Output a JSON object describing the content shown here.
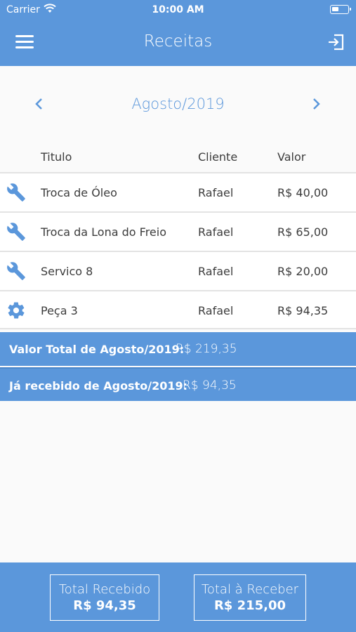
{
  "status": {
    "carrier": "Carrier",
    "time": "10:00 AM"
  },
  "nav": {
    "title": "Receitas",
    "menu_icon": "menu-icon",
    "exit_icon": "exit-icon"
  },
  "month": {
    "label": "Agosto/2019"
  },
  "table": {
    "headers": {
      "titulo": "Titulo",
      "cliente": "Cliente",
      "valor": "Valor"
    },
    "rows": [
      {
        "icon": "wrench-icon",
        "titulo": "Troca de Óleo",
        "cliente": "Rafael",
        "valor": "R$ 40,00"
      },
      {
        "icon": "wrench-icon",
        "titulo": "Troca da Lona do Freio",
        "cliente": "Rafael",
        "valor": "R$ 65,00"
      },
      {
        "icon": "wrench-icon",
        "titulo": "Servico 8",
        "cliente": "Rafael",
        "valor": "R$ 20,00"
      },
      {
        "icon": "gear-icon",
        "titulo": "Peça 3",
        "cliente": "Rafael",
        "valor": "R$ 94,35"
      }
    ]
  },
  "summary": {
    "total_label": "Valor Total de Agosto/2019:",
    "total_value": "R$ 219,35",
    "received_label": "Já recebido de Agosto/2019:",
    "received_value": "R$ 94,35"
  },
  "footer": {
    "received": {
      "label": "Total Recebido",
      "value": "R$ 94,35"
    },
    "pending": {
      "label": "Total à Receber",
      "value": "R$ 215,00"
    }
  },
  "colors": {
    "primary": "#5b97db",
    "background": "#fafafa",
    "divider": "#e3e3e3",
    "text": "#3c3c3c"
  }
}
